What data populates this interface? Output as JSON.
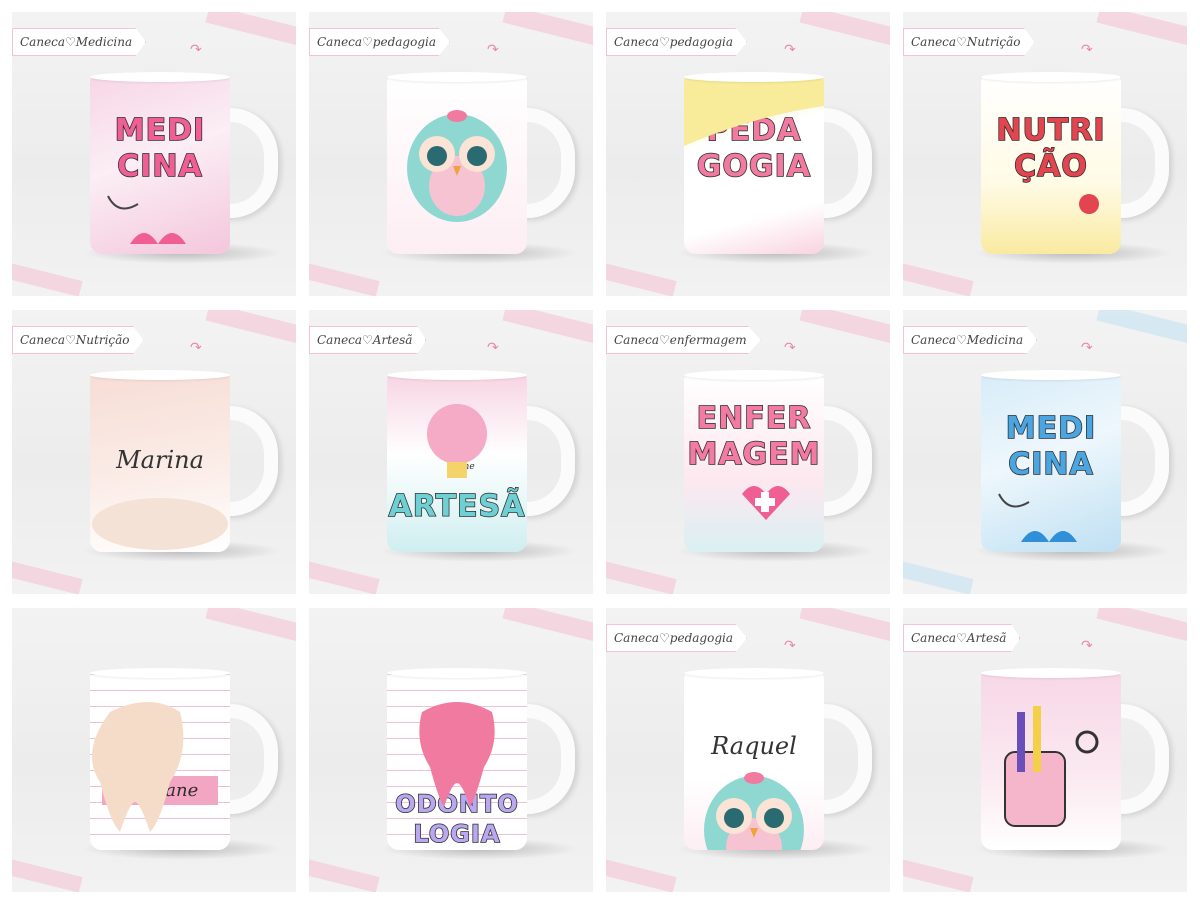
{
  "colors": {
    "pink": "#f07aa0",
    "teal": "#7fd6d2",
    "blue": "#3a86c8",
    "yellow": "#f7e48a",
    "rose": "#f6c9d6"
  },
  "tiles": [
    {
      "tag": "Caneca♡Medicina",
      "words": [
        "MEDI",
        "CINA"
      ],
      "style": "medicina-pink"
    },
    {
      "tag": "Caneca♡pedagogia",
      "words": [],
      "style": "owl"
    },
    {
      "tag": "Caneca♡pedagogia",
      "words": [
        "PEDA",
        "GOGIA"
      ],
      "style": "pedagogia"
    },
    {
      "tag": "Caneca♡Nutrição",
      "words": [
        "NUTRI",
        "ÇÃO"
      ],
      "style": "nutricao"
    },
    {
      "tag": "Caneca♡Nutrição",
      "name": "Marina",
      "style": "marina"
    },
    {
      "tag": "Caneca♡Artesã",
      "words": [
        "ARTESÃ"
      ],
      "style": "artesa",
      "small": "Aline"
    },
    {
      "tag": "Caneca♡enfermagem",
      "words": [
        "ENFER",
        "MAGEM"
      ],
      "style": "enfermagem"
    },
    {
      "tag": "Caneca♡Medicina",
      "words": [
        "MEDI",
        "CINA"
      ],
      "style": "medicina-blue"
    },
    {
      "tag": "",
      "name": "Mariane",
      "style": "dente"
    },
    {
      "tag": "",
      "words": [
        "ODONTO",
        "LOGIA"
      ],
      "style": "odonto"
    },
    {
      "tag": "Caneca♡pedagogia",
      "name": "Raquel",
      "style": "owl-name"
    },
    {
      "tag": "Caneca♡Artesã",
      "words": [],
      "style": "artesa-jar"
    }
  ]
}
